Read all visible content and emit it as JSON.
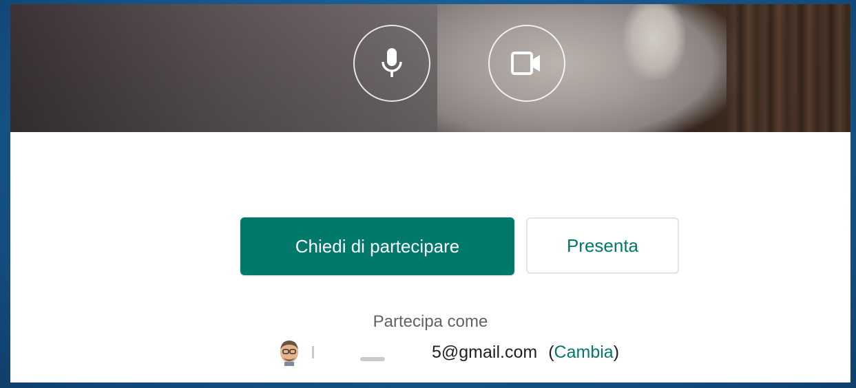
{
  "controls": {
    "mic": {
      "icon": "microphone-icon"
    },
    "camera": {
      "icon": "video-camera-icon"
    }
  },
  "actions": {
    "ask_to_join_label": "Chiedi di partecipare",
    "present_label": "Presenta"
  },
  "account": {
    "join_as_label": "Partecipa come",
    "email_visible": "5@gmail.com",
    "change_open": "(",
    "change_label": "Cambia",
    "change_close": ")",
    "avatar_icon": "user-avatar-icon"
  },
  "colors": {
    "accent": "#00796b",
    "background": "#1a5e95"
  }
}
